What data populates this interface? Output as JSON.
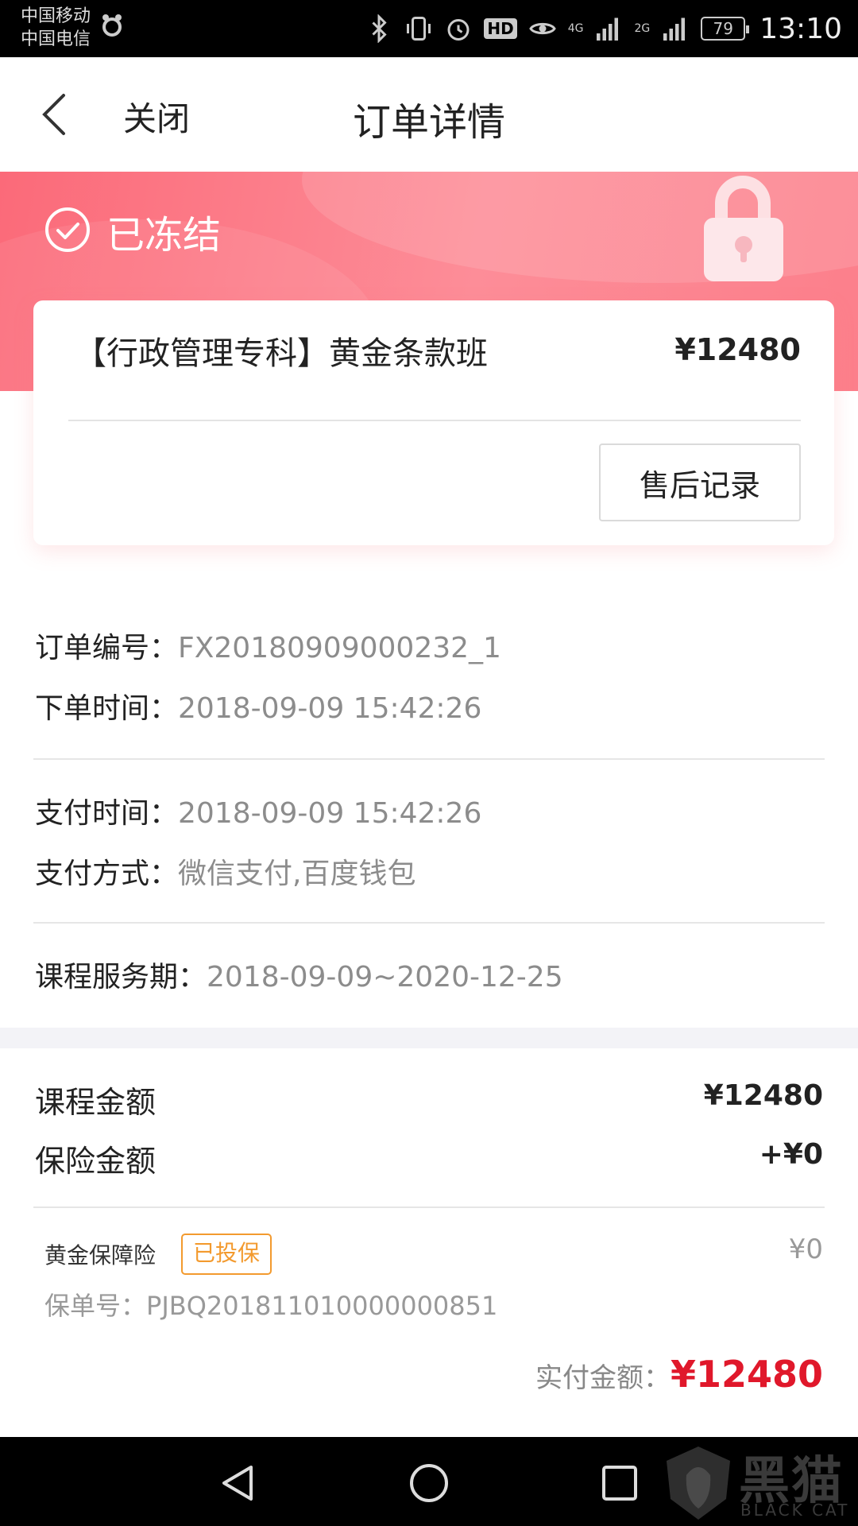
{
  "status_bar": {
    "carrier_1": "中国移动",
    "carrier_2": "中国电信",
    "network_1": "4G",
    "network_2": "2G",
    "hd_label": "HD",
    "battery": "79",
    "time": "13:10"
  },
  "header": {
    "close_label": "关闭",
    "title": "订单详情"
  },
  "order_status": {
    "label": "已冻结",
    "colors": {
      "banner": "#fb6a79",
      "total_price": "#e0182b",
      "insured_badge": "#f39a2e"
    }
  },
  "product": {
    "name": "【行政管理专科】黄金条款班",
    "price": "¥12480",
    "after_sale_button": "售后记录"
  },
  "order_info": {
    "order_no_label": "订单编号：",
    "order_no": "FX20180909000232_1",
    "order_time_label": "下单时间：",
    "order_time": "2018-09-09 15:42:26",
    "pay_time_label": "支付时间：",
    "pay_time": "2018-09-09 15:42:26",
    "pay_method_label": "支付方式：",
    "pay_method": "微信支付,百度钱包",
    "service_period_label": "课程服务期：",
    "service_period": "2018-09-09~2020-12-25"
  },
  "amounts": {
    "course_label": "课程金额",
    "course_value": "¥12480",
    "insurance_label": "保险金额",
    "insurance_value": "+¥0",
    "insurance_name": "黄金保障险",
    "insurance_status": "已投保",
    "insurance_item_value": "¥0",
    "policy_no_label": "保单号：",
    "policy_no": "PJBQ201811010000000851",
    "paid_label": "实付金额：",
    "paid_value": "¥12480"
  },
  "watermark": {
    "text": "黑猫",
    "subtext": "BLACK CAT"
  }
}
